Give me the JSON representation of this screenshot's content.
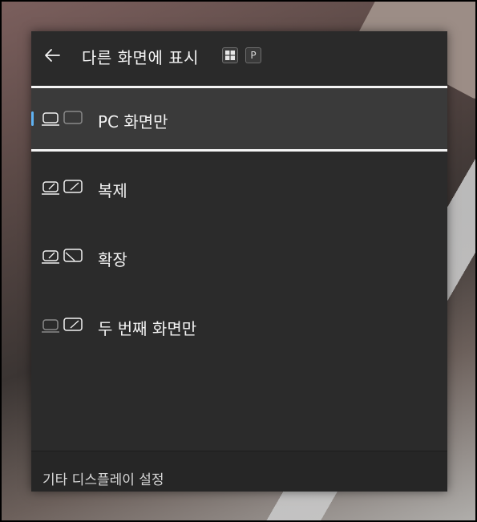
{
  "header": {
    "back_icon": "arrow-left-icon",
    "title": "다른 화면에 표시",
    "shortcut_keys": [
      "windows-logo-key",
      "P"
    ]
  },
  "options": [
    {
      "label": "PC 화면만",
      "icon": "pc-screen-only-icon",
      "selected": true
    },
    {
      "label": "복제",
      "icon": "duplicate-icon",
      "selected": false
    },
    {
      "label": "확장",
      "icon": "extend-icon",
      "selected": false
    },
    {
      "label": "두 번째 화면만",
      "icon": "second-screen-only-icon",
      "selected": false
    }
  ],
  "footer": {
    "link_label": "기타 디스플레이 설정"
  },
  "colors": {
    "panel_bg": "#2b2b2b",
    "selected_bg": "#3a3a3a",
    "accent": "#5fb2f2",
    "text": "#f3f3f3"
  }
}
